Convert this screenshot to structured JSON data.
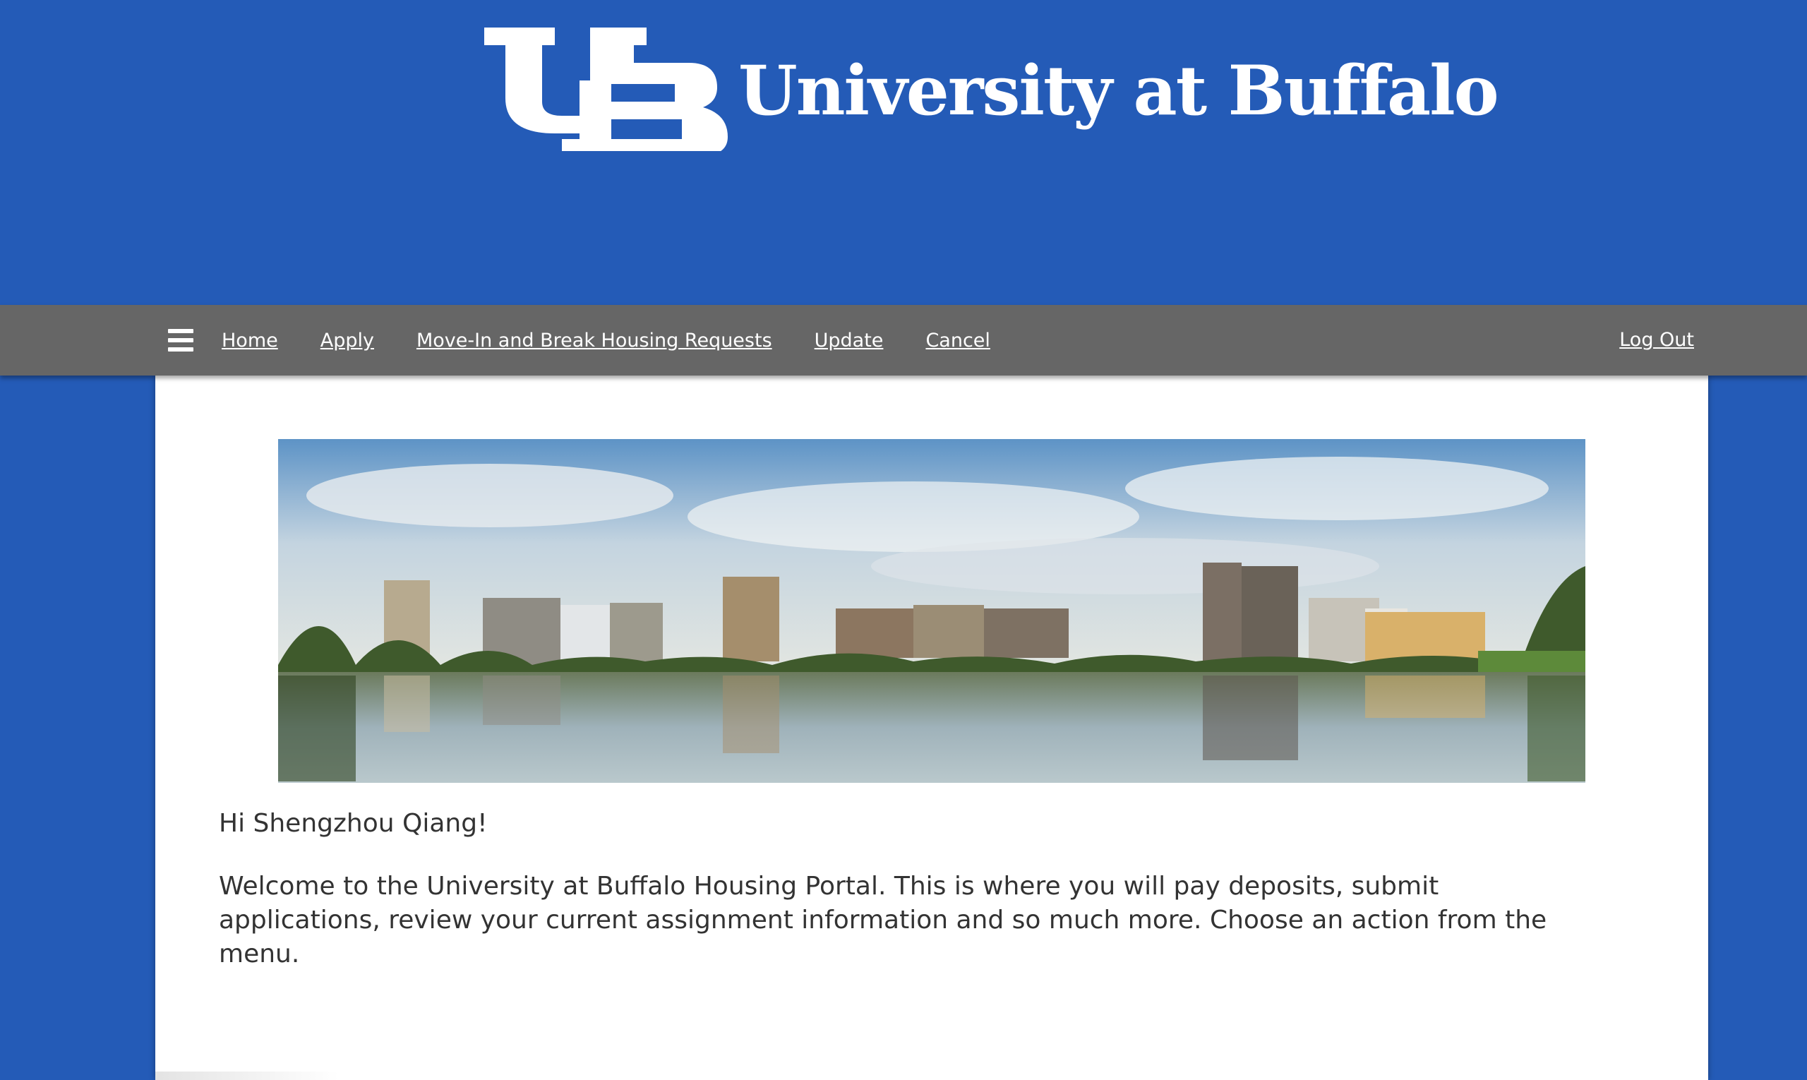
{
  "brand": {
    "name": "University at Buffalo",
    "logo_monogram": "UB"
  },
  "nav": {
    "menu_icon": "hamburger-menu-icon",
    "links": [
      {
        "label": "Home"
      },
      {
        "label": "Apply"
      },
      {
        "label": "Move-In and Break Housing Requests"
      },
      {
        "label": "Update"
      },
      {
        "label": "Cancel"
      }
    ],
    "logout_label": "Log Out"
  },
  "main": {
    "banner_alt": "",
    "greeting": "Hi Shengzhou Qiang!",
    "welcome_text": "Welcome to the University at Buffalo Housing Portal. This is where you will pay deposits, submit applications, review your current assignment information and so much more. Choose an action from the menu."
  },
  "colors": {
    "brand_blue": "#245bb7",
    "nav_gray": "#666666",
    "text": "#333333"
  }
}
